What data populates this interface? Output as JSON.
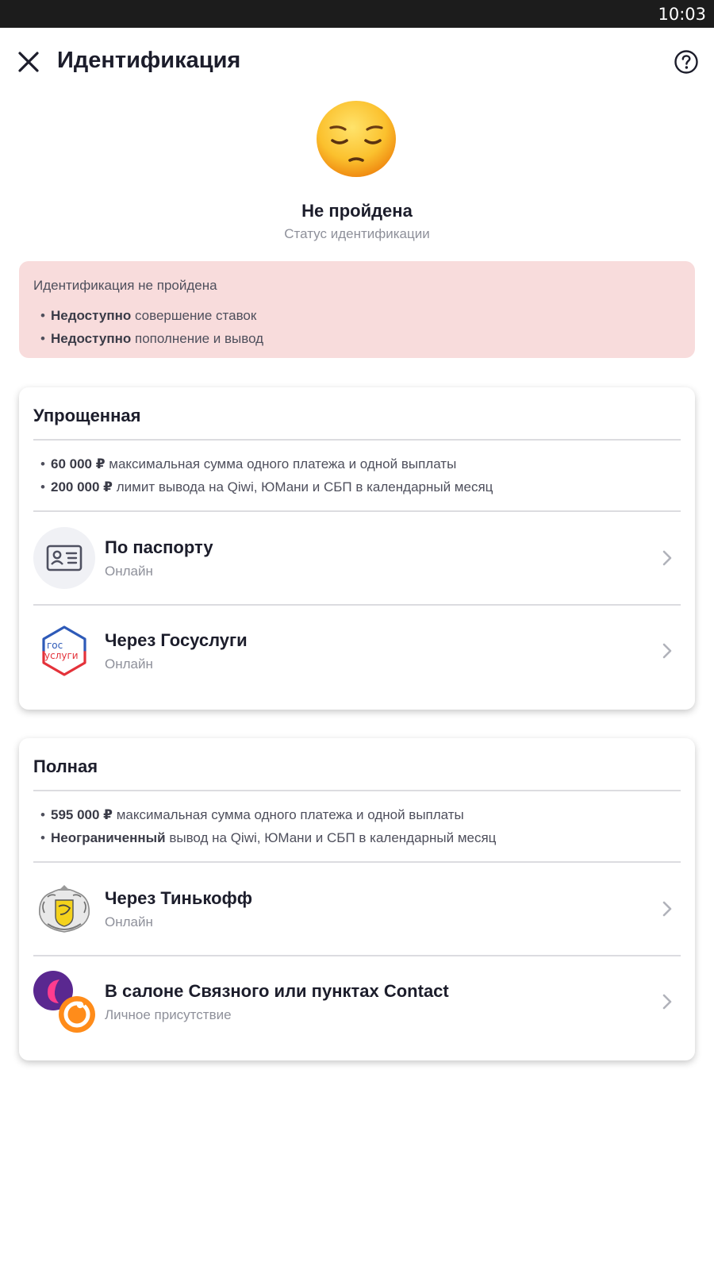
{
  "status_bar": {
    "time": "10:03"
  },
  "header": {
    "title": "Идентификация"
  },
  "status": {
    "title": "Не пройдена",
    "subtitle": "Статус идентификации"
  },
  "alert": {
    "title": "Идентификация не пройдена",
    "items": [
      {
        "bold": "Недоступно",
        "text": " совершение ставок"
      },
      {
        "bold": "Недоступно",
        "text": " пополнение и вывод"
      }
    ]
  },
  "simplified": {
    "title": "Упрощенная",
    "items": [
      {
        "bold": "60 000 ₽",
        "text": " максимальная сумма одного платежа и одной выплаты"
      },
      {
        "bold": "200 000 ₽",
        "text": " лимит вывода на Qiwi, ЮМани и СБП в календарный месяц"
      }
    ],
    "options": [
      {
        "title": "По паспорту",
        "subtitle": "Онлайн"
      },
      {
        "title": "Через Госуслуги",
        "subtitle": "Онлайн"
      }
    ]
  },
  "full": {
    "title": "Полная",
    "items": [
      {
        "bold": "595 000 ₽",
        "text": " максимальная сумма одного платежа и одной выплаты"
      },
      {
        "bold": "Неограниченный",
        "text": " вывод на Qiwi, ЮМани и СБП в календарный месяц"
      }
    ],
    "options": [
      {
        "title": "Через Тинькофф",
        "subtitle": "Онлайн"
      },
      {
        "title": "В салоне Связного или пунктах Contact",
        "subtitle": "Личное присутствие"
      }
    ]
  },
  "gosuslugi_logo_text": [
    "гос",
    "услуги"
  ],
  "colors": {
    "alert_bg": "#f8dcdc",
    "accent_text": "#1c1d2b",
    "muted_text": "#8e909a",
    "divider": "#dcdce0"
  },
  "icons": [
    "close-icon",
    "help-icon",
    "pensive-face-emoji",
    "id-card-icon",
    "gosuslugi-logo",
    "tinkoff-logo",
    "svyaznoy-contact-logo",
    "chevron-right-icon"
  ]
}
